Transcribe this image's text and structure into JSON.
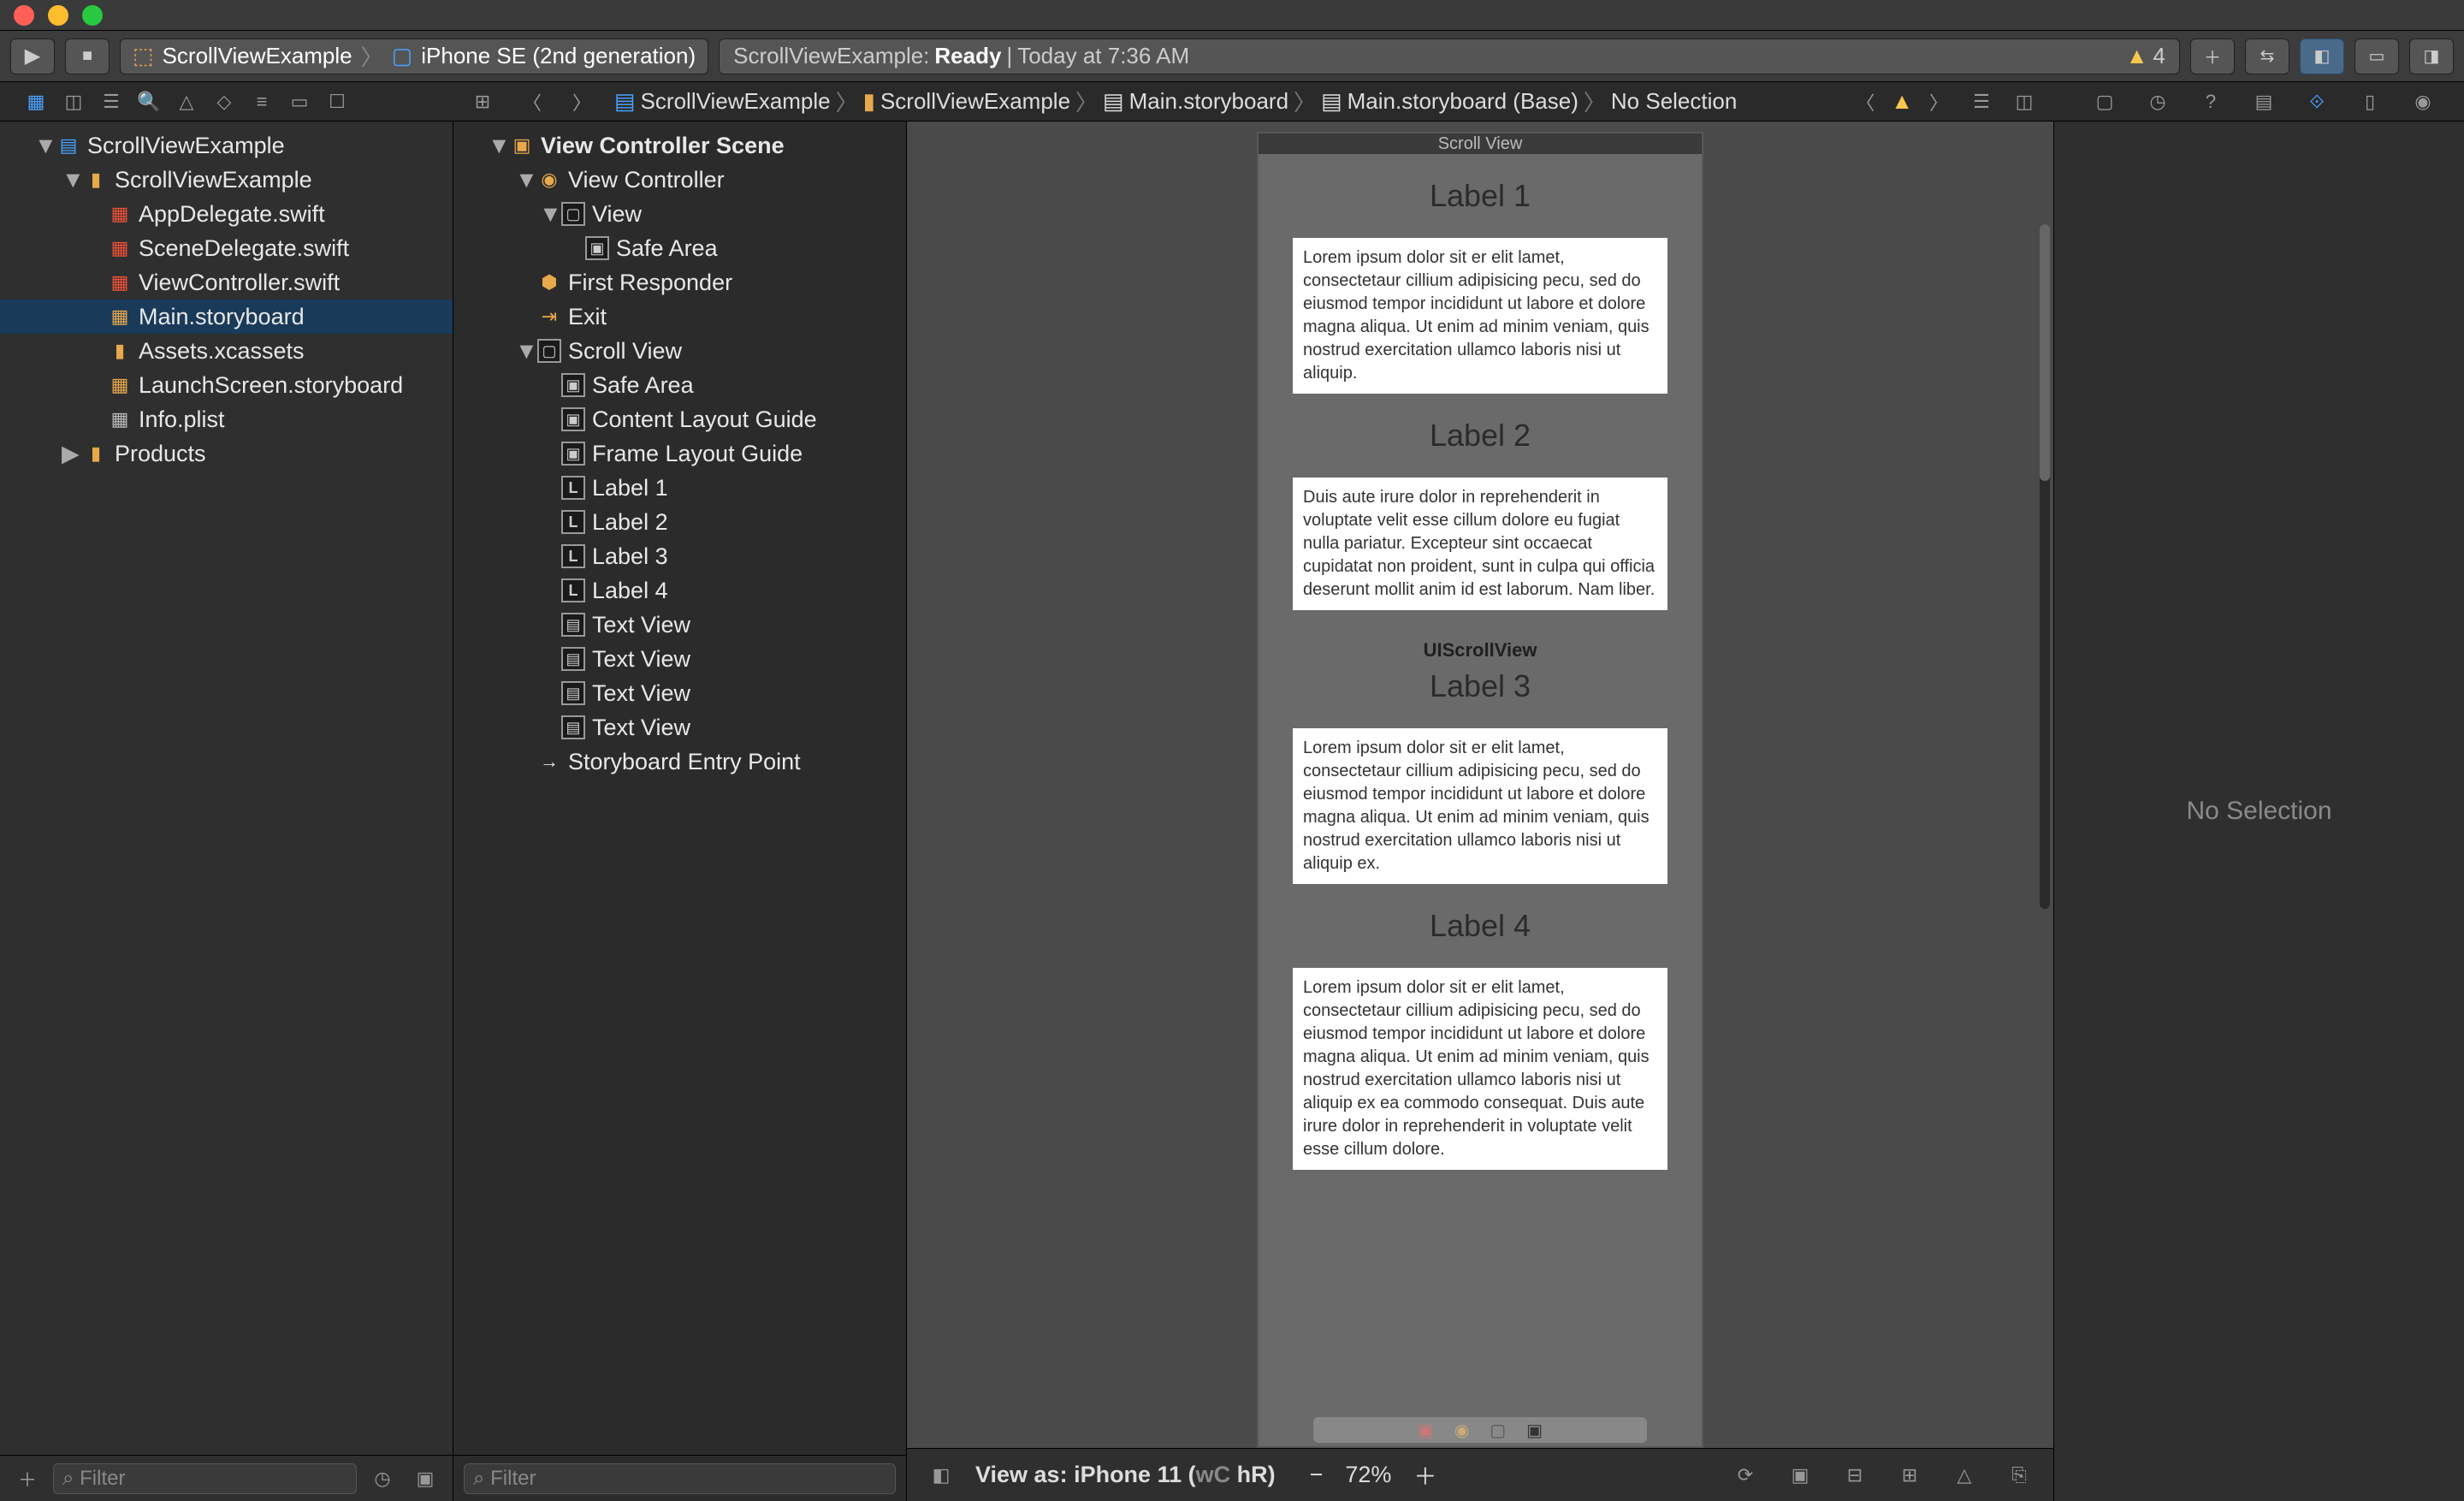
{
  "window": {
    "close": "",
    "minimize": "",
    "maximize": ""
  },
  "toolbar": {
    "scheme_project": "ScrollViewExample",
    "scheme_device": "iPhone SE (2nd generation)",
    "status_prefix": "ScrollViewExample:",
    "status_ready": "Ready",
    "status_sep": "|",
    "status_time": "Today at 7:36 AM",
    "warn_count": "4"
  },
  "crumb": {
    "c1": "ScrollViewExample",
    "c2": "ScrollViewExample",
    "c3": "Main.storyboard",
    "c4": "Main.storyboard (Base)",
    "c5": "No Selection"
  },
  "navigator": {
    "project": "ScrollViewExample",
    "group": "ScrollViewExample",
    "files": {
      "app_delegate": "AppDelegate.swift",
      "scene_delegate": "SceneDelegate.swift",
      "view_controller": "ViewController.swift",
      "main_storyboard": "Main.storyboard",
      "assets": "Assets.xcassets",
      "launch_storyboard": "LaunchScreen.storyboard",
      "info_plist": "Info.plist"
    },
    "products": "Products",
    "filter_ph": "Filter"
  },
  "outline": {
    "scene": "View Controller Scene",
    "vc": "View Controller",
    "view": "View",
    "safe_area": "Safe Area",
    "first_responder": "First Responder",
    "exit": "Exit",
    "scroll_view": "Scroll View",
    "safe_area2": "Safe Area",
    "content_guide": "Content Layout Guide",
    "frame_guide": "Frame Layout Guide",
    "label1": "Label 1",
    "label2": "Label 2",
    "label3": "Label 3",
    "label4": "Label 4",
    "text_view1": "Text View",
    "text_view2": "Text View",
    "text_view3": "Text View",
    "text_view4": "Text View",
    "entry": "Storyboard Entry Point",
    "filter_ph": "Filter"
  },
  "canvas": {
    "device_title": "Scroll View",
    "ui_scroll": "UIScrollView",
    "labels": {
      "l1": "Label 1",
      "l2": "Label 2",
      "l3": "Label 3",
      "l4": "Label 4"
    },
    "text1": "Lorem ipsum dolor sit er elit lamet, consectetaur cillium adipisicing pecu, sed do eiusmod tempor incididunt ut labore et dolore magna aliqua. Ut enim ad minim veniam, quis nostrud exercitation ullamco laboris nisi ut aliquip.",
    "text2": "Duis aute irure dolor in reprehenderit in voluptate velit esse cillum dolore eu fugiat nulla pariatur. Excepteur sint occaecat cupidatat non proident, sunt in culpa qui officia deserunt mollit anim id est laborum. Nam liber.",
    "text3": "Lorem ipsum dolor sit er elit lamet, consectetaur cillium adipisicing pecu, sed do eiusmod tempor incididunt ut labore et dolore magna aliqua. Ut enim ad minim veniam, quis nostrud exercitation ullamco laboris nisi ut aliquip ex.",
    "text4": "Lorem ipsum dolor sit er elit lamet, consectetaur cillium adipisicing pecu, sed do eiusmod tempor incididunt ut labore et dolore magna aliqua. Ut enim ad minim veniam, quis nostrud exercitation ullamco laboris nisi ut aliquip ex ea commodo consequat. Duis aute irure dolor in reprehenderit in voluptate velit esse cillum dolore."
  },
  "bottom": {
    "view_as": "View as: iPhone 11 (",
    "wC": "wC",
    "hR": " hR)",
    "zoom": "72%"
  },
  "inspector": {
    "no_selection": "No Selection"
  }
}
